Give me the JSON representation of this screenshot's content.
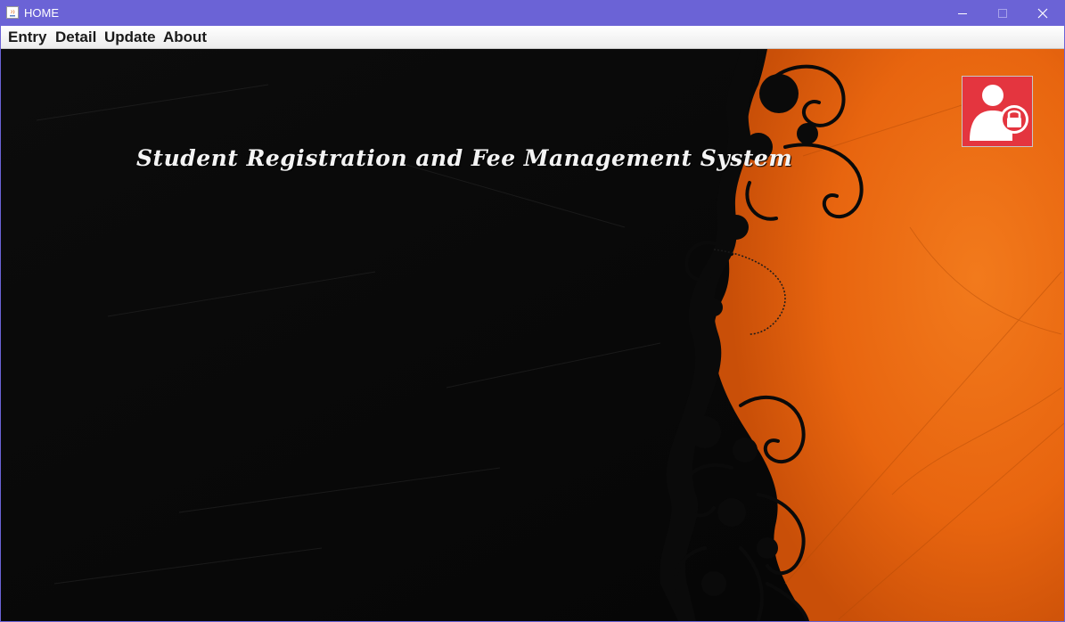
{
  "window": {
    "title": "HOME",
    "title_bar_color": "#6b63d6",
    "controls": {
      "minimize_icon": "minimize-icon",
      "maximize_icon": "maximize-icon",
      "close_icon": "close-icon"
    }
  },
  "menubar": {
    "items": [
      {
        "label": "Entry"
      },
      {
        "label": "Detail"
      },
      {
        "label": "Update"
      },
      {
        "label": "About"
      }
    ]
  },
  "main": {
    "title": "Student Registration and Fee Management System",
    "background_colors": {
      "left": "#080808",
      "right": "#e8650f"
    },
    "login_button": {
      "icon": "user-lock-icon",
      "color": "#e4353f"
    }
  }
}
